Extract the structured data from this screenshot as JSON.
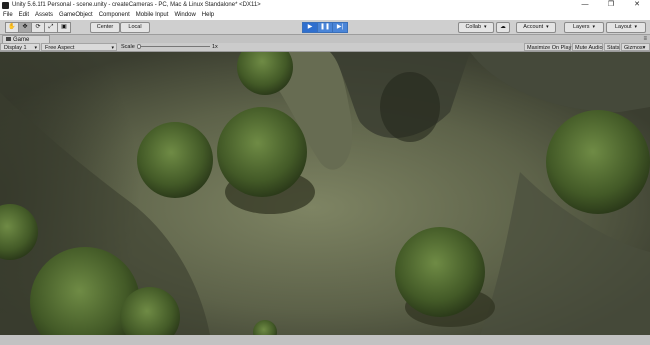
{
  "window": {
    "title": "Unity 5.6.1f1 Personal - scene.unity - createCameras - PC, Mac & Linux Standalone* <DX11>",
    "controls": [
      "—",
      "❐",
      "✕"
    ]
  },
  "menu": [
    "File",
    "Edit",
    "Assets",
    "GameObject",
    "Component",
    "Mobile Input",
    "Window",
    "Help"
  ],
  "toolbar": {
    "tools": [
      "✋",
      "✥",
      "⟳",
      "⤢",
      "▣"
    ],
    "pivot_label": "Center",
    "space_label": "Local",
    "play_icons": [
      "▶",
      "❚❚",
      "▶|"
    ],
    "collab_label": "Collab",
    "cloud_icon": "☁",
    "account_label": "Account",
    "layers_label": "Layers",
    "layout_label": "Layout",
    "dropdown_arrow": "▾"
  },
  "game_tab": {
    "label": "Game",
    "menu_glyph": "≡"
  },
  "game_controls": {
    "display": "Display 1",
    "aspect": "Free Aspect",
    "scale_label": "Scale",
    "scale_value": "1x",
    "scale_fraction": 0.0,
    "maximize_on_play": "Maximize On Play",
    "mute_audio": "Mute Audio",
    "stats": "Stats",
    "gizmos": "Gizmos",
    "arrow": "▾"
  },
  "colors": {
    "play_accent": "#4a85d8",
    "terrain_dark": "#3f4234",
    "terrain_light": "#7d8261",
    "foliage": "#4e6a2e"
  }
}
